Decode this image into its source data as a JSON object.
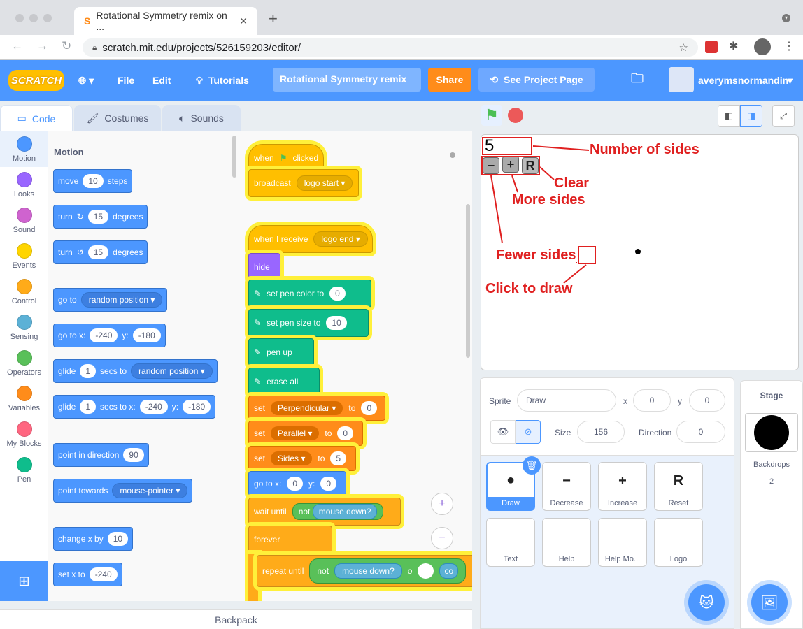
{
  "browser": {
    "tab_title": "Rotational Symmetry remix on ...",
    "url": "scratch.mit.edu/projects/526159203/editor/"
  },
  "menu": {
    "logo": "SCRATCH",
    "file": "File",
    "edit": "Edit",
    "tutorials": "Tutorials",
    "project_title": "Rotational Symmetry remix",
    "share": "Share",
    "see_project": "See Project Page",
    "username": "averymsnormandin"
  },
  "tabs": {
    "code": "Code",
    "costumes": "Costumes",
    "sounds": "Sounds"
  },
  "categories": [
    {
      "label": "Motion",
      "color": "#4c97ff"
    },
    {
      "label": "Looks",
      "color": "#9966ff"
    },
    {
      "label": "Sound",
      "color": "#cf63cf"
    },
    {
      "label": "Events",
      "color": "#ffd500"
    },
    {
      "label": "Control",
      "color": "#ffab19"
    },
    {
      "label": "Sensing",
      "color": "#5cb1d6"
    },
    {
      "label": "Operators",
      "color": "#59c059"
    },
    {
      "label": "Variables",
      "color": "#ff8c1a"
    },
    {
      "label": "My Blocks",
      "color": "#ff6680"
    },
    {
      "label": "Pen",
      "color": "#0fbd8c"
    }
  ],
  "palette": {
    "heading": "Motion",
    "move": {
      "a": "move",
      "v": "10",
      "b": "steps"
    },
    "turn_r": {
      "a": "turn",
      "icon": "↻",
      "v": "15",
      "b": "degrees"
    },
    "turn_l": {
      "a": "turn",
      "icon": "↺",
      "v": "15",
      "b": "degrees"
    },
    "goto": {
      "a": "go to",
      "d": "random position"
    },
    "gotoxy": {
      "a": "go to x:",
      "x": "-240",
      "yl": "y:",
      "y": "-180"
    },
    "glide1": {
      "a": "glide",
      "v": "1",
      "b": "secs to",
      "d": "random position"
    },
    "glide2": {
      "a": "glide",
      "v": "1",
      "b": "secs to x:",
      "x": "-240",
      "yl": "y:",
      "y": "-180"
    },
    "pointdir": {
      "a": "point in direction",
      "v": "90"
    },
    "pointtow": {
      "a": "point towards",
      "d": "mouse-pointer"
    },
    "changex": {
      "a": "change x by",
      "v": "10"
    },
    "setx": {
      "a": "set x to",
      "v": "-240"
    }
  },
  "script": {
    "when_flag": {
      "a": "when",
      "b": "clicked"
    },
    "broadcast": {
      "a": "broadcast",
      "d": "logo start"
    },
    "when_receive": {
      "a": "when I receive",
      "d": "logo end"
    },
    "hide": "hide",
    "pen_color": {
      "a": "set pen color to",
      "v": "0"
    },
    "pen_size": {
      "a": "set pen size to",
      "v": "10"
    },
    "pen_up": "pen up",
    "erase": "erase all",
    "set1": {
      "a": "set",
      "d": "Perpendicular",
      "b": "to",
      "v": "0"
    },
    "set2": {
      "a": "set",
      "d": "Parallel",
      "b": "to",
      "v": "0"
    },
    "set3": {
      "a": "set",
      "d": "Sides",
      "b": "to",
      "v": "5"
    },
    "gotoxy": {
      "a": "go to x:",
      "x": "0",
      "yl": "y:",
      "y": "0"
    },
    "wait": {
      "a": "wait until",
      "n": "not",
      "s": "mouse down?"
    },
    "forever": "forever",
    "repeat": {
      "a": "repeat until",
      "n": "not",
      "s": "mouse down?",
      "o": "o",
      "eq": "=",
      "c": "co"
    }
  },
  "backpack": "Backpack",
  "stage": {
    "counter": "5",
    "minus": "−",
    "plus": "+",
    "reset": "R",
    "ann_sides": "Number of sides",
    "ann_clear": "Clear",
    "ann_more": "More sides",
    "ann_fewer": "Fewer sides",
    "ann_draw": "Click to draw"
  },
  "sprite_info": {
    "sprite_label": "Sprite",
    "name": "Draw",
    "x_label": "x",
    "x": "0",
    "y_label": "y",
    "y": "0",
    "size_label": "Size",
    "size": "156",
    "dir_label": "Direction",
    "dir": "0"
  },
  "sprites": [
    {
      "name": "Draw",
      "icon": "●"
    },
    {
      "name": "Decrease",
      "icon": "−"
    },
    {
      "name": "Increase",
      "icon": "+"
    },
    {
      "name": "Reset",
      "icon": "R"
    },
    {
      "name": "Text",
      "icon": ""
    },
    {
      "name": "Help",
      "icon": ""
    },
    {
      "name": "Help Mo...",
      "icon": ""
    },
    {
      "name": "Logo",
      "icon": ""
    }
  ],
  "stage_pane": {
    "title": "Stage",
    "backdrops_label": "Backdrops",
    "backdrops_count": "2"
  }
}
